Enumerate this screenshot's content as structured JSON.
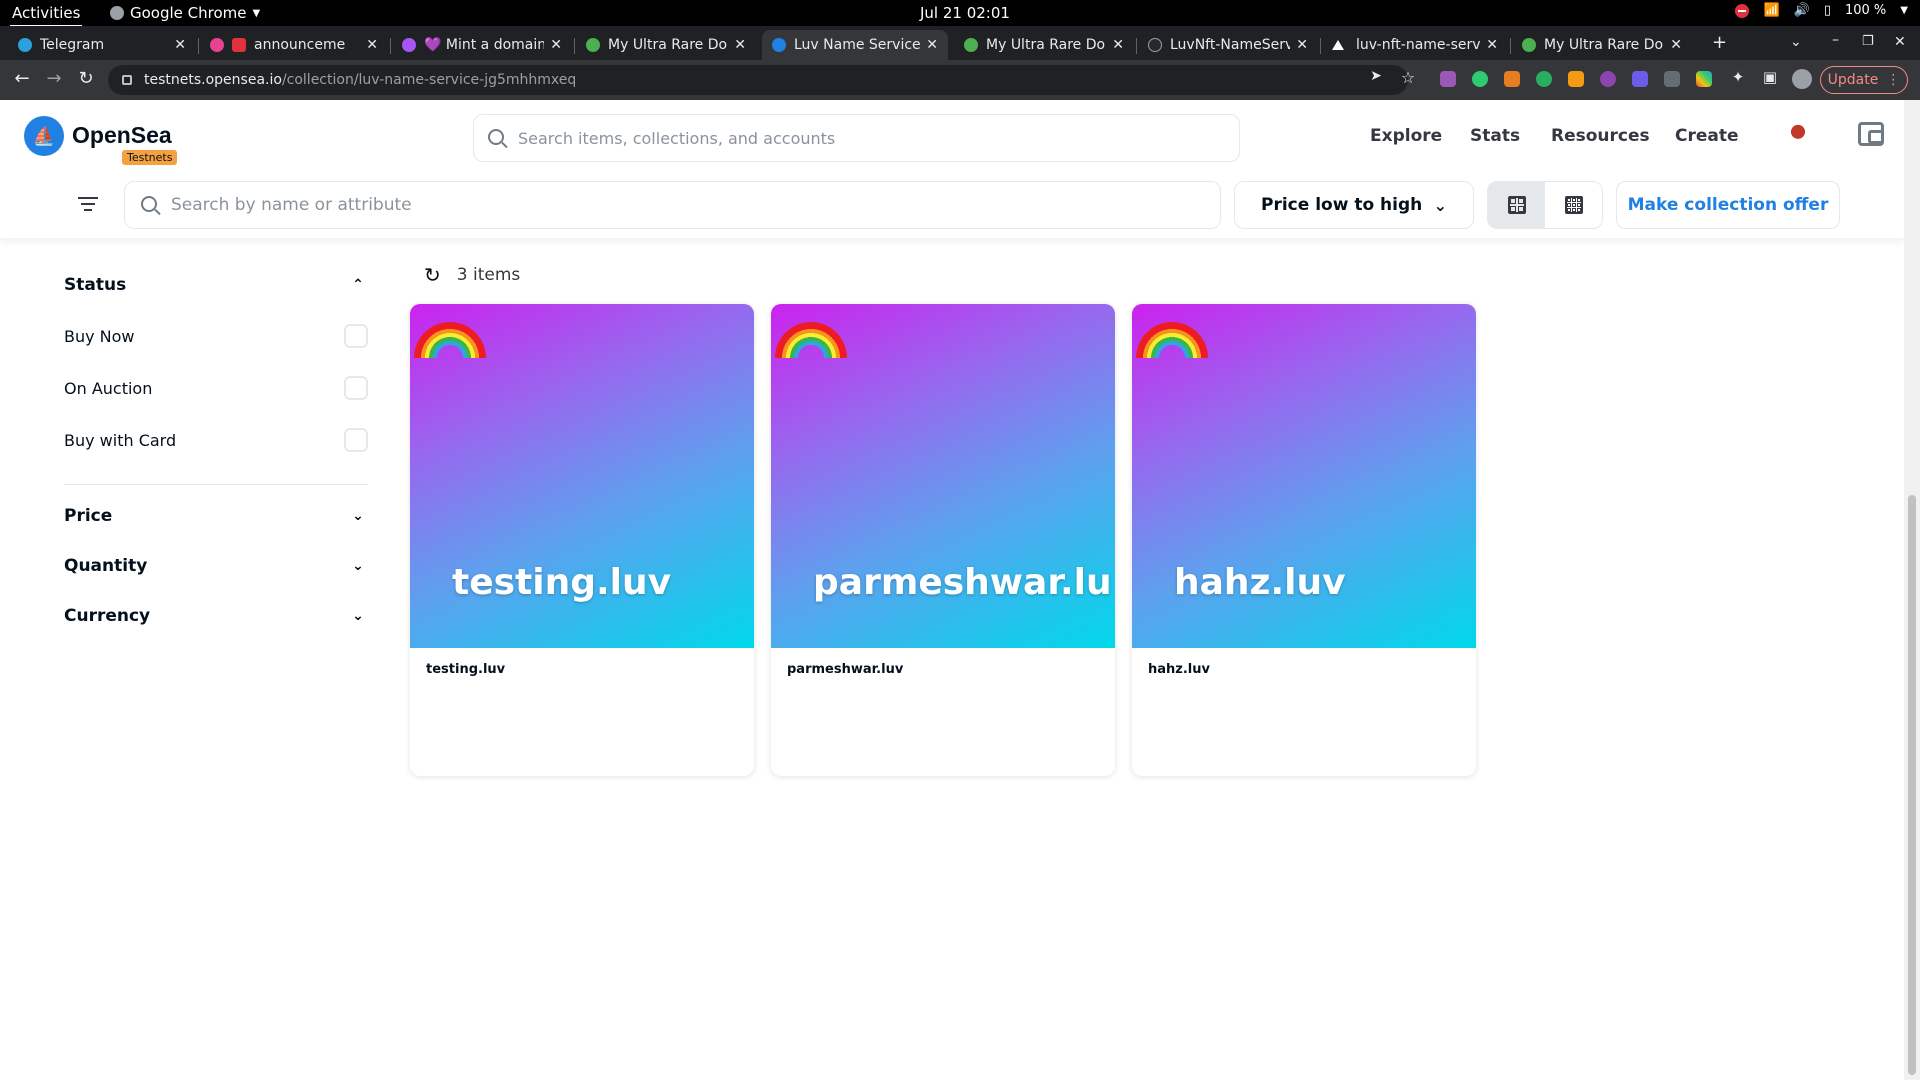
{
  "system_bar": {
    "activities": "Activities",
    "app_name": "Google Chrome",
    "clock": "Jul 21  02:01",
    "battery": "100 %"
  },
  "tabs": [
    {
      "title": "Telegram",
      "favicon_color": "#2aa1da"
    },
    {
      "title": "announceme",
      "favicon_color": "#e84393"
    },
    {
      "title": "💜 Mint a domain",
      "favicon_color": "#a855f7"
    },
    {
      "title": "My Ultra Rare Don",
      "favicon_color": "#4caf50"
    },
    {
      "title": "Luv Name Service",
      "favicon_color": "#2081e2"
    },
    {
      "title": "My Ultra Rare Don",
      "favicon_color": "#4caf50"
    },
    {
      "title": "LuvNft-NameServ",
      "favicon_color": "#24292e"
    },
    {
      "title": "luv-nft-name-serv",
      "favicon_color": "#ffffff"
    },
    {
      "title": "My Ultra Rare Don",
      "favicon_color": "#4caf50"
    }
  ],
  "omnibox": {
    "host": "testnets.opensea.io",
    "path": "/collection/luv-name-service-jg5mhhmxeq"
  },
  "update_label": "Update",
  "header": {
    "brand": "OpenSea",
    "badge": "Testnets",
    "search_placeholder": "Search items, collections, and accounts",
    "nav": [
      "Explore",
      "Stats",
      "Resources",
      "Create"
    ]
  },
  "subbar": {
    "attr_search_placeholder": "Search by name or attribute",
    "sort_label": "Price low to high",
    "collection_offer": "Make collection offer"
  },
  "sidebar": {
    "status_label": "Status",
    "status_options": [
      "Buy Now",
      "On Auction",
      "Buy with Card"
    ],
    "sections": [
      "Price",
      "Quantity",
      "Currency"
    ]
  },
  "results": {
    "count_label": "3 items",
    "items": [
      {
        "art_text": "testing.luv",
        "name": "testing.luv"
      },
      {
        "art_text": "parmeshwar.lu",
        "name": "parmeshwar.luv"
      },
      {
        "art_text": "hahz.luv",
        "name": "hahz.luv"
      }
    ]
  },
  "colors": {
    "accent": "#2081e2",
    "badge": "#f5a142"
  }
}
